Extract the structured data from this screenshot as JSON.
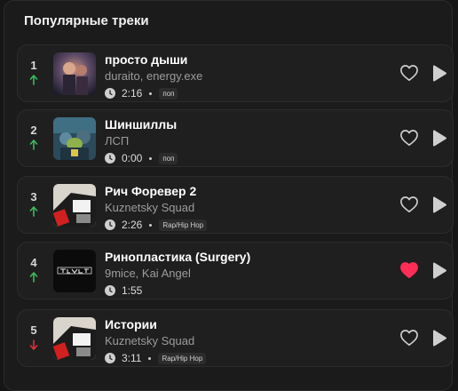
{
  "section": {
    "title": "Популярные треки"
  },
  "tracks": [
    {
      "rank": "1",
      "trend": "up",
      "title": "просто дыши",
      "artist": "duraito, energy.exe",
      "duration": "2:16",
      "genre": "поп",
      "liked": false
    },
    {
      "rank": "2",
      "trend": "up",
      "title": "Шиншиллы",
      "artist": "ЛСП",
      "duration": "0:00",
      "genre": "поп",
      "liked": false
    },
    {
      "rank": "3",
      "trend": "up",
      "title": "Рич Форевер 2",
      "artist": "Kuznetsky Squad",
      "duration": "2:26",
      "genre": "Rap/Hip Hop",
      "liked": false
    },
    {
      "rank": "4",
      "trend": "up",
      "title": "Ринопластика (Surgery)",
      "artist": "9mice, Kai Angel",
      "duration": "1:55",
      "genre": "",
      "liked": true
    },
    {
      "rank": "5",
      "trend": "down",
      "title": "Истории",
      "artist": "Kuznetsky Squad",
      "duration": "3:11",
      "genre": "Rap/Hip Hop",
      "liked": false
    }
  ],
  "icons": {
    "trend_up": "arrow-up-icon",
    "trend_down": "arrow-down-icon",
    "duration": "clock-icon",
    "like": "heart-icon",
    "play": "play-icon"
  },
  "colors": {
    "trend_up": "#3dbb5a",
    "trend_down": "#e0303a",
    "liked": "#ff2d55",
    "icon": "#cfcfcf"
  }
}
